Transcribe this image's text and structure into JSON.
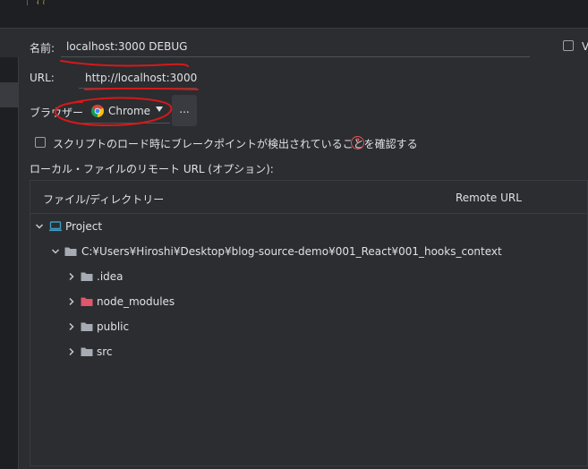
{
  "top_fragment": "{ (",
  "form": {
    "name_label": "名前:",
    "name_value": "localhost:3000 DEBUG",
    "right_checkbox_label": "V",
    "url_label": "URL:",
    "url_value": "http://localhost:3000",
    "browser_label": "ブラウザー:",
    "browser_value": "Chrome",
    "more_button": "...",
    "breakpoint_checkbox_label": "スクリプトのロード時にブレークポイントが検出されていることを確認する",
    "help_icon": "?",
    "remote_section_label": "ローカル・ファイルのリモート URL (オプション):"
  },
  "table": {
    "col_file": "ファイル/ディレクトリー",
    "col_remote": "Remote URL",
    "rows": [
      {
        "label": "Project",
        "icon": "monitor-icon",
        "expanded": true
      },
      {
        "label": "C:¥Users¥Hiroshi¥Desktop¥blog-source-demo¥001_React¥001_hooks_context",
        "icon": "folder-icon",
        "expanded": true
      },
      {
        "label": ".idea",
        "icon": "folder-icon",
        "expanded": false
      },
      {
        "label": "node_modules",
        "icon": "excluded-folder-icon",
        "expanded": false
      },
      {
        "label": "public",
        "icon": "folder-icon",
        "expanded": false
      },
      {
        "label": "src",
        "icon": "folder-icon",
        "expanded": false
      }
    ]
  },
  "colors": {
    "background": "#2b2d30",
    "dark_panel": "#1e1f22",
    "text": "#dfe1e5",
    "folder": "#a7abb3",
    "excluded_folder": "#e0566b",
    "project_icon": "#3d9dc3",
    "annotation_red": "#d31a1a"
  }
}
